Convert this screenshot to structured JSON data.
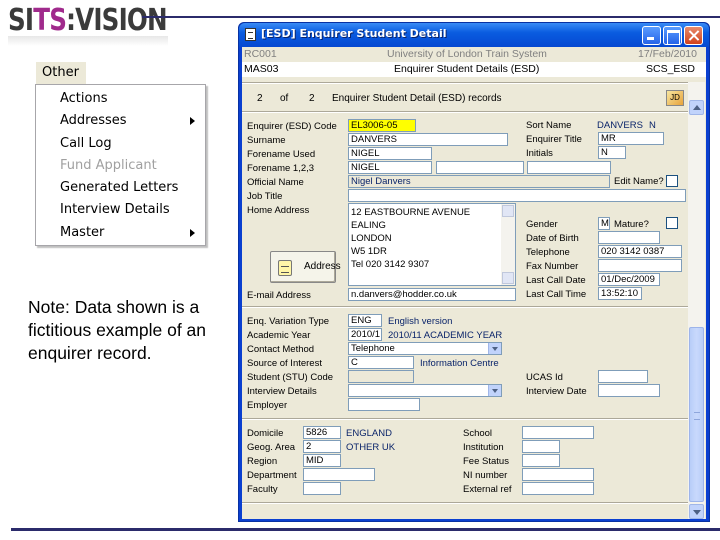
{
  "logo": {
    "part1": "SI",
    "accent": "TS",
    "part2": ":VISION"
  },
  "menu": {
    "header": "Other",
    "items": [
      {
        "label": "Actions",
        "disabled": false,
        "submenu": false
      },
      {
        "label": "Addresses",
        "disabled": false,
        "submenu": true
      },
      {
        "label": "Call Log",
        "disabled": false,
        "submenu": false
      },
      {
        "label": "Fund Applicant",
        "disabled": true,
        "submenu": false
      },
      {
        "label": "Generated Letters",
        "disabled": false,
        "submenu": false
      },
      {
        "label": "Interview Details",
        "disabled": false,
        "submenu": false
      },
      {
        "label": "Master",
        "disabled": false,
        "submenu": true
      }
    ]
  },
  "note": "Note: Data shown is a fictitious example of an enquirer record.",
  "window": {
    "title": "[ESD] Enquirer Student Detail",
    "header": {
      "code1": "RC001",
      "system": "University of London Train System",
      "date": "17/Feb/2010",
      "code2": "MAS03",
      "screen": "Enquirer Student Details (ESD)",
      "screen_code": "SCS_ESD"
    },
    "records": {
      "current": "2",
      "of": "of",
      "total": "2",
      "label": "Enquirer Student Detail (ESD) records",
      "nav_icon": "JD"
    },
    "personal": {
      "esd_code_label": "Enquirer (ESD) Code",
      "esd_code": "EL3006-05",
      "surname_label": "Surname",
      "surname": "DANVERS",
      "forename_used_label": "Forename Used",
      "forename_used": "NIGEL",
      "forenames_label": "Forename 1,2,3",
      "forename1": "NIGEL",
      "forename2": "",
      "official_name_label": "Official Name",
      "official_name": "Nigel Danvers",
      "job_title_label": "Job Title",
      "job_title": "",
      "home_address_label": "Home Address",
      "address_lines": [
        "12 EASTBOURNE AVENUE",
        "EALING",
        "LONDON",
        "W5 1DR",
        "Tel      020 3142 9307"
      ],
      "address_button": "Address",
      "email_label": "E-mail Address",
      "email": "n.danvers@hodder.co.uk",
      "sort_name_label": "Sort Name",
      "sort_name": "DANVERS",
      "sort_initial": "N",
      "title_label": "Enquirer Title",
      "title": "MR",
      "initials_label": "Initials",
      "initials": "N",
      "edit_name_label": "Edit Name?",
      "gender_label": "Gender",
      "gender": "M",
      "mature_label": "Mature?",
      "dob_label": "Date of Birth",
      "dob": "",
      "telephone_label": "Telephone",
      "telephone": "020 3142 0387",
      "fax_label": "Fax Number",
      "fax": "",
      "last_call_date_label": "Last Call Date",
      "last_call_date": "01/Dec/2009",
      "last_call_time_label": "Last Call Time",
      "last_call_time": "13:52:10"
    },
    "enquiry": {
      "variation_label": "Enq. Variation Type",
      "variation_code": "ENG",
      "variation_desc": "English version",
      "year_label": "Academic Year",
      "year_code": "2010/1",
      "year_desc": "2010/11 ACADEMIC YEAR",
      "contact_label": "Contact Method",
      "contact": "Telephone",
      "source_label": "Source of Interest",
      "source_code": "C",
      "source_desc": "Information Centre",
      "stu_label": "Student (STU) Code",
      "stu": "",
      "interview_label": "Interview Details",
      "interview": "",
      "employer_label": "Employer",
      "employer": "",
      "ucas_label": "UCAS Id",
      "ucas": "",
      "interview_date_label": "Interview Date",
      "interview_date": ""
    },
    "other": {
      "domicile_label": "Domicile",
      "domicile_code": "5826",
      "domicile_desc": "ENGLAND",
      "geog_label": "Geog. Area",
      "geog_code": "2",
      "geog_desc": "OTHER UK",
      "region_label": "Region",
      "region": "MID",
      "department_label": "Department",
      "department": "",
      "faculty_label": "Faculty",
      "faculty": "",
      "school_label": "School",
      "school": "",
      "institution_label": "Institution",
      "institution": "",
      "fee_status_label": "Fee Status",
      "fee_status": "",
      "ni_label": "NI number",
      "ni": "",
      "external_label": "External ref",
      "external": ""
    }
  }
}
